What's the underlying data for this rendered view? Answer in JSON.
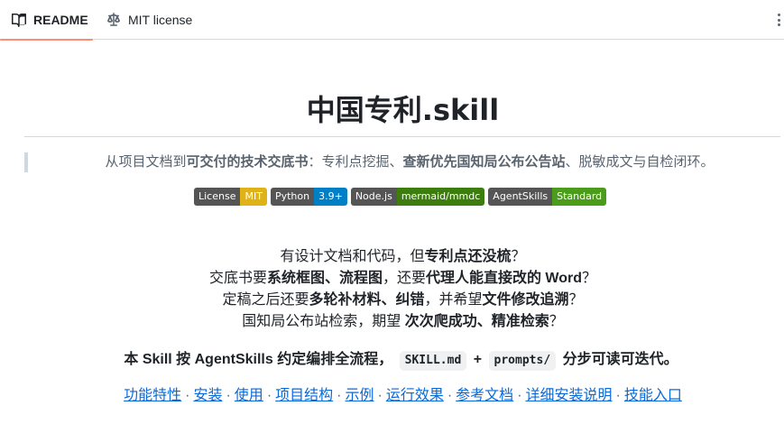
{
  "tabs": [
    {
      "label": "README",
      "icon": "book-icon",
      "active": true
    },
    {
      "label": "MIT license",
      "icon": "law-icon",
      "active": false
    }
  ],
  "title": "中国专利.skill",
  "quote": {
    "part1": "从项目文档到",
    "bold1": "可交付的技术交底书",
    "part2": "：专利点挖掘、",
    "bold2": "查新优先国知局公布公告站",
    "part3": "、脱敏成文与自检闭环。"
  },
  "badges": [
    {
      "label": "License",
      "value": "MIT",
      "color": "#dfb317"
    },
    {
      "label": "Python",
      "value": "3.9+",
      "color": "#007ec6"
    },
    {
      "label": "Node.js",
      "value": "mermaid/mmdc",
      "color": "#3c7d0e"
    },
    {
      "label": "AgentSkills",
      "value": "Standard",
      "color": "#4c9c1c"
    }
  ],
  "lines": [
    {
      "a": "有设计文档和代码，但",
      "b": "专利点还没梳",
      "c": "？"
    },
    {
      "a": "交底书要",
      "b": "系统框图、流程图",
      "c": "，还要",
      "d": "代理人能直接改的 Word",
      "e": "？"
    },
    {
      "a": "定稿之后还要",
      "b": "多轮补材料、纠错",
      "c": "，并希望",
      "d": "文件修改追溯",
      "e": "？"
    },
    {
      "a": "国知局公布站检索，期望 ",
      "b": "次次爬成功、精准检索",
      "c": "？"
    }
  ],
  "statement": {
    "prefix": "本 Skill 按 AgentSkills 约定编排全流程，",
    "code1": "SKILL.md",
    "plus": "+",
    "code2": "prompts/",
    "suffix": "分步可读可迭代。"
  },
  "links": [
    "功能特性",
    "安装",
    "使用",
    "项目结构",
    "示例",
    "运行效果",
    "参考文档",
    "详细安装说明",
    "技能入口"
  ],
  "separator": "·"
}
